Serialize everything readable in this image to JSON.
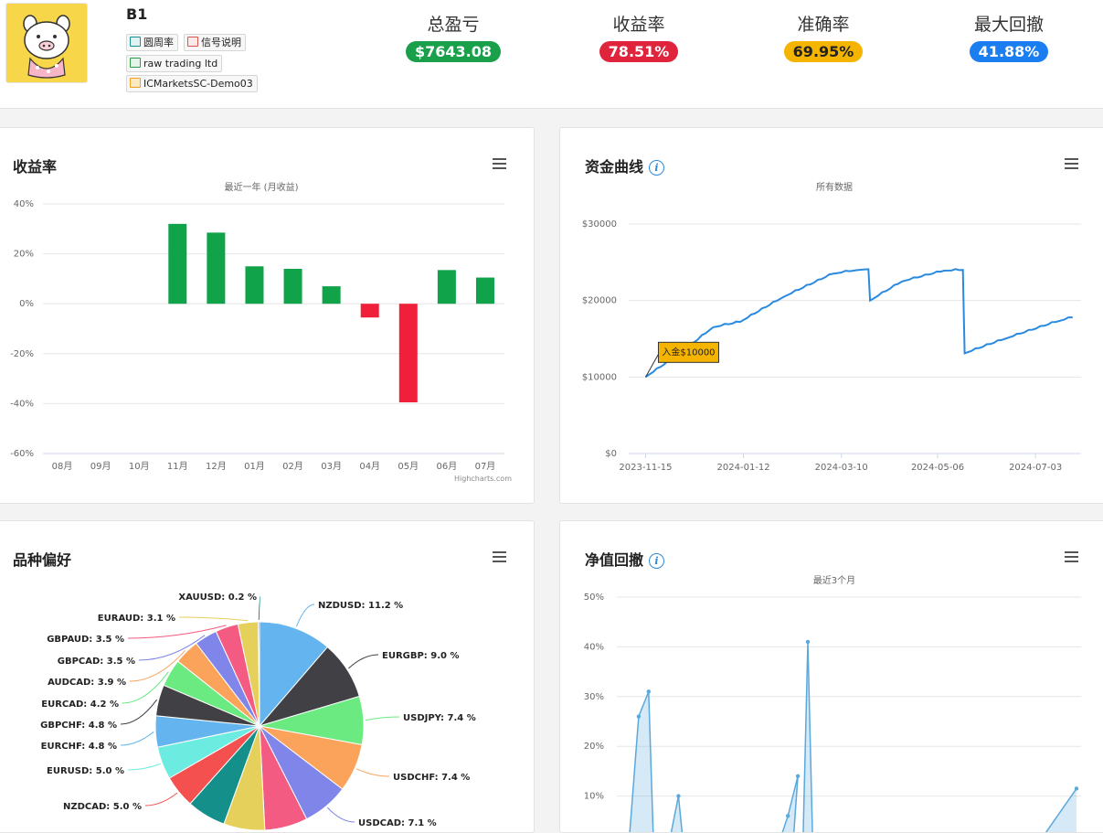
{
  "account": {
    "name": "B1",
    "tags": [
      {
        "label": "圆周率",
        "icon": "user-card-icon",
        "color": "#1a8f8f"
      },
      {
        "label": "信号说明",
        "icon": "document-icon",
        "color": "#d9534f"
      },
      {
        "label": "raw trading ltd",
        "icon": "broker-icon",
        "color": "#2e9a45"
      },
      {
        "label": "ICMarketsSC-Demo03",
        "icon": "server-icon",
        "color": "#f0a020"
      }
    ]
  },
  "stats": [
    {
      "label": "总盈亏",
      "value": "$7643.08",
      "color": "#1a9f4a"
    },
    {
      "label": "收益率",
      "value": "78.51%",
      "color": "#e0243c"
    },
    {
      "label": "准确率",
      "value": "69.95%",
      "color": "#f4b400"
    },
    {
      "label": "最大回撤",
      "value": "41.88%",
      "color": "#1a7ef0"
    }
  ],
  "panels": {
    "returns": {
      "title": "收益率",
      "subtitle": "最近一年 (月收益)",
      "credit": "Highcharts.com"
    },
    "equity": {
      "title": "资金曲线",
      "subtitle": "所有数据"
    },
    "symbols": {
      "title": "品种偏好"
    },
    "drawdown": {
      "title": "净值回撤",
      "subtitle": "最近3个月"
    }
  },
  "chart_data": [
    {
      "type": "bar",
      "title": "收益率",
      "subtitle": "最近一年 (月收益)",
      "categories": [
        "08月",
        "09月",
        "10月",
        "11月",
        "12月",
        "01月",
        "02月",
        "03月",
        "04月",
        "05月",
        "06月",
        "07月"
      ],
      "values": [
        0,
        0,
        0,
        32,
        28.5,
        15,
        14,
        7,
        -5.5,
        -39.5,
        13.5,
        10.5
      ],
      "ylim": [
        -60,
        40
      ],
      "yticks": [
        "40%",
        "20%",
        "0%",
        "-20%",
        "-40%",
        "-60%"
      ],
      "colors": {
        "positive": "#10a34a",
        "negative": "#f0203a"
      }
    },
    {
      "type": "line",
      "title": "资金曲线",
      "subtitle": "所有数据",
      "xlabels": [
        "2023-11-15",
        "2024-01-12",
        "2024-03-10",
        "2024-05-06",
        "2024-07-03"
      ],
      "yticks": [
        "$30000",
        "$20000",
        "$10000",
        "$0"
      ],
      "ylim": [
        0,
        30000
      ],
      "annotation": "入金$10000",
      "series": [
        {
          "x": "2023-11-15",
          "y": 10000
        },
        {
          "x": "2023-12-05",
          "y": 13000
        },
        {
          "x": "2023-12-25",
          "y": 16500
        },
        {
          "x": "2024-01-10",
          "y": 17200
        },
        {
          "x": "2024-02-05",
          "y": 20500
        },
        {
          "x": "2024-03-05",
          "y": 23500
        },
        {
          "x": "2024-03-20",
          "y": 24000
        },
        {
          "x": "2024-03-26",
          "y": 24100
        },
        {
          "x": "2024-03-27",
          "y": 20000
        },
        {
          "x": "2024-04-15",
          "y": 22500
        },
        {
          "x": "2024-05-10",
          "y": 23900
        },
        {
          "x": "2024-05-21",
          "y": 24000
        },
        {
          "x": "2024-05-22",
          "y": 13100
        },
        {
          "x": "2024-06-15",
          "y": 15000
        },
        {
          "x": "2024-07-15",
          "y": 17200
        },
        {
          "x": "2024-07-25",
          "y": 17800
        }
      ],
      "color": "#2a8ae0"
    },
    {
      "type": "pie",
      "title": "品种偏好",
      "slices": [
        {
          "label": "NZDUSD: 11.2 %",
          "value": 11.2,
          "color": "#64b5ef"
        },
        {
          "label": "EURGBP: 9.0 %",
          "value": 9.0,
          "color": "#404045"
        },
        {
          "label": "USDJPY: 7.4 %",
          "value": 7.4,
          "color": "#6aea80"
        },
        {
          "label": "USDCHF: 7.4 %",
          "value": 7.4,
          "color": "#fba35a"
        },
        {
          "label": "USDCAD: 7.1 %",
          "value": 7.1,
          "color": "#8085ea"
        },
        {
          "label": "",
          "value": 6.6,
          "color": "#f45b82"
        },
        {
          "label": "",
          "value": 6.3,
          "color": "#e5d05b"
        },
        {
          "label": "",
          "value": 6.0,
          "color": "#148f89"
        },
        {
          "label": "NZDCAD: 5.0 %",
          "value": 5.0,
          "color": "#f45050"
        },
        {
          "label": "EURUSD: 5.0 %",
          "value": 5.0,
          "color": "#6cece0"
        },
        {
          "label": "EURCHF: 4.8 %",
          "value": 4.8,
          "color": "#64b5ef"
        },
        {
          "label": "GBPCHF: 4.8 %",
          "value": 4.8,
          "color": "#404045"
        },
        {
          "label": "EURCAD: 4.2 %",
          "value": 4.2,
          "color": "#6aea80"
        },
        {
          "label": "AUDCAD: 3.9 %",
          "value": 3.9,
          "color": "#fba35a"
        },
        {
          "label": "GBPCAD: 3.5 %",
          "value": 3.5,
          "color": "#8085ea"
        },
        {
          "label": "GBPAUD: 3.5 %",
          "value": 3.5,
          "color": "#f45b82"
        },
        {
          "label": "EURAUD: 3.1 %",
          "value": 3.1,
          "color": "#e5d05b"
        },
        {
          "label": "XAUUSD: 0.2 %",
          "value": 0.2,
          "color": "#148f89"
        }
      ]
    },
    {
      "type": "area",
      "title": "净值回撤",
      "subtitle": "最近3个月",
      "yticks": [
        "50%",
        "40%",
        "30%",
        "20%",
        "10%"
      ],
      "ylim": [
        0,
        50
      ],
      "x": [
        0,
        2,
        4,
        5,
        8,
        10,
        11,
        28,
        30,
        32,
        34,
        33,
        35,
        36,
        37,
        38,
        40,
        55,
        70,
        75,
        76,
        79,
        80,
        81,
        82,
        90
      ],
      "values": [
        0,
        26,
        31,
        0,
        0,
        10,
        0,
        0,
        0,
        6,
        14,
        0,
        0,
        41,
        0,
        0,
        0,
        0,
        0,
        0,
        1,
        0,
        0,
        0,
        0,
        11.5
      ],
      "color": "#5aa9dc"
    }
  ]
}
